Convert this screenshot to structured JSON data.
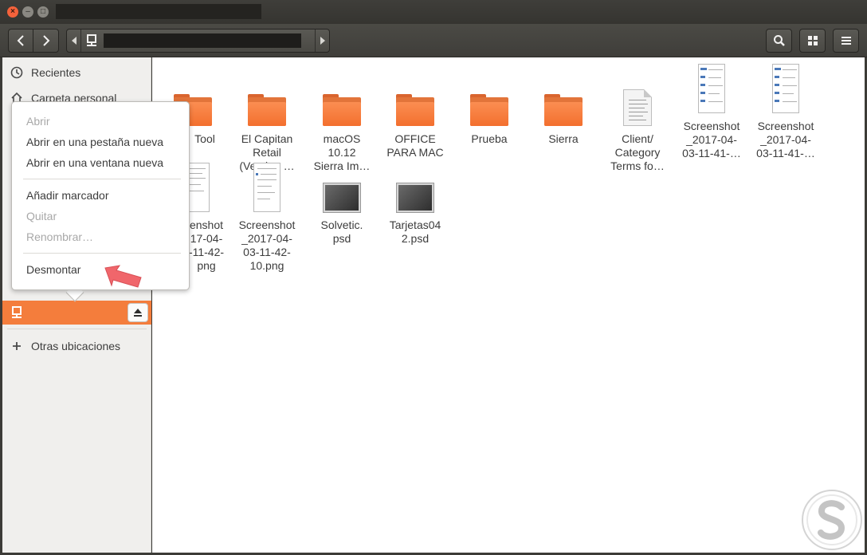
{
  "window": {
    "title": ""
  },
  "toolbar": {
    "path_label": ""
  },
  "sidebar": {
    "items": [
      {
        "label": "Recientes"
      },
      {
        "label": "Carpeta personal"
      },
      {
        "label": ""
      },
      {
        "label": "Otras ubicaciones"
      }
    ]
  },
  "context_menu": {
    "items": [
      {
        "label": "Abrir",
        "enabled": false
      },
      {
        "label": "Abrir en una pestaña nueva",
        "enabled": true
      },
      {
        "label": "Abrir en una ventana nueva",
        "enabled": true
      },
      {
        "label": "Añadir marcador",
        "enabled": true
      },
      {
        "label": "Quitar",
        "enabled": false
      },
      {
        "label": "Renombrar…",
        "enabled": false
      },
      {
        "label": "Desmontar",
        "enabled": true
      }
    ]
  },
  "files": [
    {
      "label": "Tool",
      "type": "folder"
    },
    {
      "label": "El Capitan\nRetail\n(Version …",
      "type": "folder"
    },
    {
      "label": "macOS\n10.12\nSierra Im…",
      "type": "folder"
    },
    {
      "label": "OFFICE\nPARA MAC",
      "type": "folder"
    },
    {
      "label": "Prueba",
      "type": "folder"
    },
    {
      "label": "Sierra",
      "type": "folder"
    },
    {
      "label": "Client/\nCategory\nTerms fo…",
      "type": "document"
    },
    {
      "label": "Screenshot\n_2017-04-\n03-11-41-…",
      "type": "image"
    },
    {
      "label": "Screenshot\n_2017-04-\n03-11-41-…",
      "type": "image"
    },
    {
      "label": "enshot\n17-04-\n-11-42-\npng",
      "type": "image"
    },
    {
      "label": "Screenshot\n_2017-04-\n03-11-42-\n10.png",
      "type": "image"
    },
    {
      "label": "Solvetic.\npsd",
      "type": "psd"
    },
    {
      "label": "Tarjetas04\n2.psd",
      "type": "psd"
    }
  ],
  "colors": {
    "accent": "#f47d3c",
    "folder": "#f36f2e",
    "arrow": "#f0666b"
  },
  "icons": [
    "back-icon",
    "forward-icon",
    "search-icon",
    "grid-view-icon",
    "hamburger-menu-icon",
    "clock-icon",
    "home-icon",
    "drive-icon",
    "eject-icon",
    "plus-icon"
  ]
}
